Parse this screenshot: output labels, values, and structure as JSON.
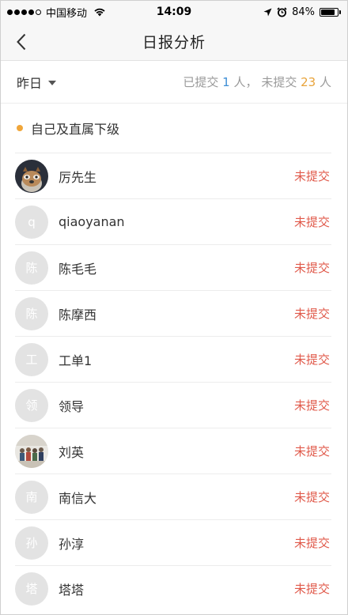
{
  "status_bar": {
    "carrier": "中国移动",
    "time": "14:09",
    "battery": "84%",
    "battery_level": 0.84
  },
  "nav": {
    "title": "日报分析",
    "back_icon": "chevron-left-icon"
  },
  "filter": {
    "date": "昨日",
    "submitted_label": "已提交",
    "submitted_count": "1",
    "person_unit": "人",
    "separator": "，",
    "unsubmitted_label": "未提交",
    "unsubmitted_count": "23",
    "blue": "#3f8fd6",
    "orange": "#e8a33a"
  },
  "group": {
    "title": "自己及直属下级",
    "dot_color": "#f0a63a"
  },
  "items": [
    {
      "name": "厉先生",
      "avatar_text": "",
      "avatar_type": "photo-raccoon",
      "status": "未提交"
    },
    {
      "name": "qiaoyanan",
      "avatar_text": "q",
      "avatar_type": "text",
      "status": "未提交"
    },
    {
      "name": "陈毛毛",
      "avatar_text": "陈",
      "avatar_type": "text",
      "status": "未提交"
    },
    {
      "name": "陈摩西",
      "avatar_text": "陈",
      "avatar_type": "text",
      "status": "未提交"
    },
    {
      "name": "工单1",
      "avatar_text": "工",
      "avatar_type": "text",
      "status": "未提交"
    },
    {
      "name": "领导",
      "avatar_text": "领",
      "avatar_type": "text",
      "status": "未提交"
    },
    {
      "name": "刘英",
      "avatar_text": "",
      "avatar_type": "photo-group",
      "status": "未提交"
    },
    {
      "name": "南信大",
      "avatar_text": "南",
      "avatar_type": "text",
      "status": "未提交"
    },
    {
      "name": "孙淳",
      "avatar_text": "孙",
      "avatar_type": "text",
      "status": "未提交"
    },
    {
      "name": "塔塔",
      "avatar_text": "塔",
      "avatar_type": "text",
      "status": "未提交"
    }
  ],
  "colors": {
    "status_red": "#e0594a"
  }
}
